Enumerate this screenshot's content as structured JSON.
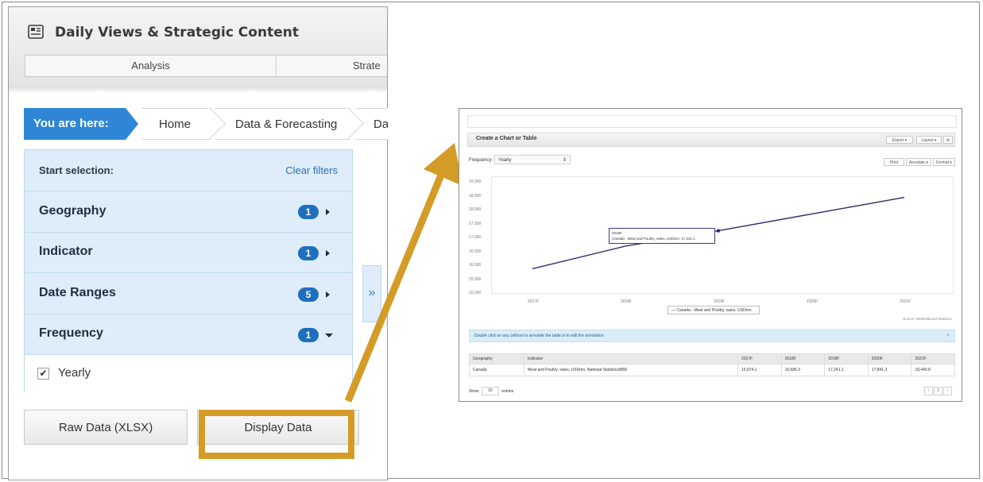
{
  "left_panel": {
    "title": "Daily Views & Strategic Content",
    "tabs": [
      "Analysis",
      "Strate"
    ],
    "breadcrumb": {
      "you_are_here": "You are here:",
      "items": [
        "Home",
        "Data & Forecasting",
        "Dat"
      ]
    },
    "selection": {
      "start_label": "Start selection:",
      "clear_filters": "Clear filters",
      "filters": [
        {
          "label": "Geography",
          "count": "1",
          "caret": "right"
        },
        {
          "label": "Indicator",
          "count": "1",
          "caret": "right"
        },
        {
          "label": "Date Ranges",
          "count": "5",
          "caret": "right"
        },
        {
          "label": "Frequency",
          "count": "1",
          "caret": "down"
        }
      ],
      "yearly_option": "Yearly",
      "yearly_checked": true,
      "expand_glyph": "»"
    },
    "buttons": {
      "raw_data": "Raw Data (XLSX)",
      "display_data": "Display Data"
    }
  },
  "highlight_color": "#d49b26",
  "right_screenshot": {
    "header_title": "Create a Chart or Table",
    "header_buttons": [
      "Export ▾",
      "Layout ▾",
      "⚙"
    ],
    "frequency_label": "Frequency:",
    "frequency_value": "Yearly",
    "chart_buttons": [
      "Print",
      "Annotate ▾",
      "Format ▾"
    ],
    "chart": {
      "y_ticks": [
        "19,000",
        "18,500",
        "18,000",
        "17,500",
        "17,000",
        "16,500",
        "16,000",
        "15,500",
        "15,000"
      ],
      "x_ticks": [
        "2017F",
        "2018F",
        "2019F",
        "2020F",
        "2021F"
      ],
      "legend": "— Canada - Meat and Poultry, sales, USDmn",
      "tooltip_line1": "2019F",
      "tooltip_line2": "Canada - Meat and Poultry, sales, USDmn: 17,241.1",
      "source": "Source: BMI/National Statistics"
    },
    "info_text": "Double click on any cell/row to annotate the table or to edit the annotation",
    "table": {
      "headers": [
        "Geography",
        "Indicator",
        "2017F",
        "2018F",
        "2019F",
        "2020F",
        "2021F"
      ],
      "rows": [
        [
          "Canada",
          "Meat and Poultry, sales, USDmn, National Statistics/BMI",
          "15,874.1",
          "16,686.3",
          "17,241.1",
          "17,841.3",
          "18,440.8"
        ]
      ]
    },
    "show_label": "Show",
    "show_value": "10",
    "entries_label": "entries",
    "pager": [
      "‹",
      "1",
      "›"
    ]
  },
  "chart_data": {
    "type": "line",
    "x": [
      "2017F",
      "2018F",
      "2019F",
      "2020F",
      "2021F"
    ],
    "series": [
      {
        "name": "Canada - Meat and Poultry, sales, USDmn",
        "values": [
          15874.1,
          16686.3,
          17241.1,
          17841.3,
          18440.8
        ]
      }
    ],
    "ylim": [
      15000,
      19000
    ],
    "grid": false,
    "legend": "bottom"
  }
}
